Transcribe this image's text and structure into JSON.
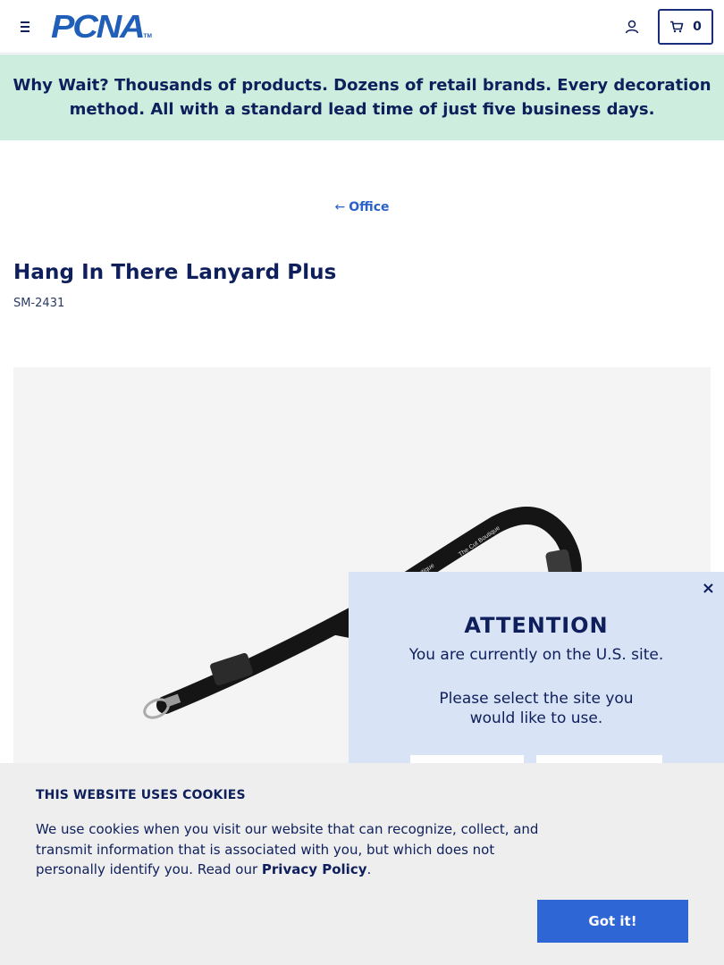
{
  "header": {
    "logo_text": "PCNA",
    "logo_tm": "TM",
    "cart_count": "0"
  },
  "promo": {
    "lead": "Why Wait?",
    "text": " Thousands of products. Dozens of retail brands. Every decoration method. All with a standard lead time of just five business days."
  },
  "breadcrumb": {
    "back_label": "Office"
  },
  "product": {
    "title": "Hang In There Lanyard Plus",
    "sku": "SM-2431"
  },
  "site_modal": {
    "close": "×",
    "heading": "ATTENTION",
    "line1": "You are currently on the U.S. site.",
    "line2": "Please select the site you",
    "line3": "would like to use."
  },
  "cookie_banner": {
    "title": "THIS WEBSITE USES COOKIES",
    "text": "We use cookies when you visit our website that can recognize, collect, and transmit information that is associated with you, but which does not personally identify you. Read our ",
    "link": "Privacy Policy",
    "suffix": ".",
    "accept_label": "Got it!"
  },
  "colors": {
    "navy": "#0e1f5b",
    "brand_blue": "#1f5fb9",
    "promo_bg": "#cdeede",
    "modal_bg": "#d9e3f6",
    "button_blue": "#2f66d6"
  }
}
